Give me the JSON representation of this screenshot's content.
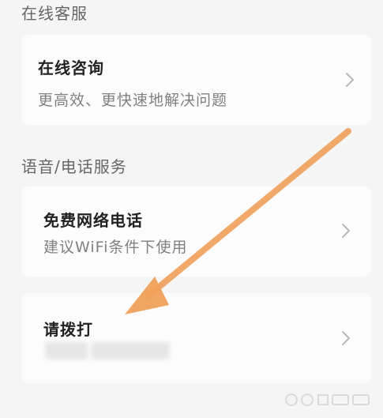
{
  "sections": [
    {
      "title": "在线客服",
      "cards": [
        {
          "title": "在线咨询",
          "subtitle": "更高效、更快速地解决问题"
        }
      ]
    },
    {
      "title": "语音/电话服务",
      "cards": [
        {
          "title": "免费网络电话",
          "subtitle": "建议WiFi条件下使用"
        },
        {
          "title": "请拨打",
          "subtitle": ""
        }
      ]
    }
  ],
  "colors": {
    "background": "#f5f5f5",
    "card": "#fcfcfc",
    "arrow": "#f0a05a",
    "title_text": "#222222",
    "subtitle_text": "#808080",
    "section_text": "#666666"
  },
  "icons": {
    "chevron": "chevron-right-icon",
    "annotation": "orange-arrow-icon"
  }
}
